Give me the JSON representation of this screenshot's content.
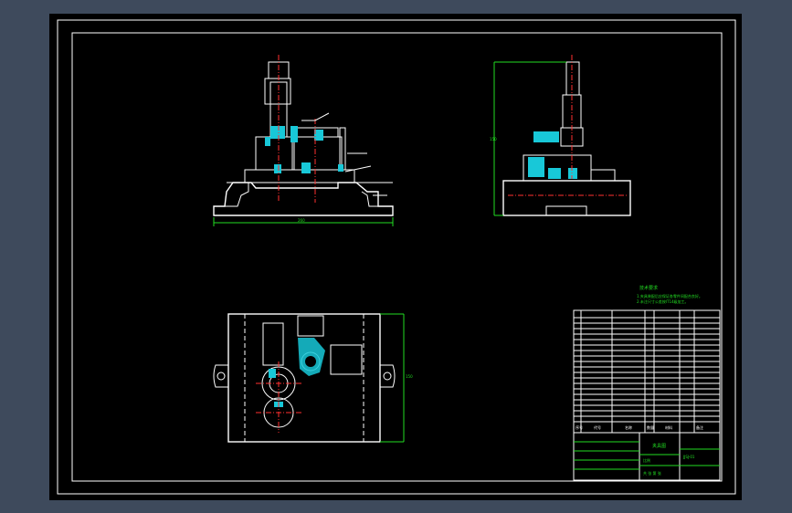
{
  "drawing": {
    "tech_req_title": "技术要求",
    "tech_req_lines": [
      "1.夹具装配后应保证各零件间配合良好。",
      "2.未注尺寸公差按IT14级加工。"
    ],
    "front_view_dim": "260",
    "side_view_dim": "150",
    "top_view_dim": "150",
    "title_block": {
      "drawing_name": "夹具图",
      "drawing_number": "JJSJ-01",
      "scale_label": "比例",
      "sheet_label": "共 张 第 张"
    },
    "bom_headers": [
      "序号",
      "代号",
      "名称",
      "数量",
      "材料",
      "备注"
    ],
    "colors": {
      "background": "#000000",
      "frame": "#ffffff",
      "accent_cyan": "#18c8d8",
      "dimension_green": "#22dd22",
      "centerline_red": "#ff3030",
      "app_chrome": "#3e4a5c"
    }
  }
}
